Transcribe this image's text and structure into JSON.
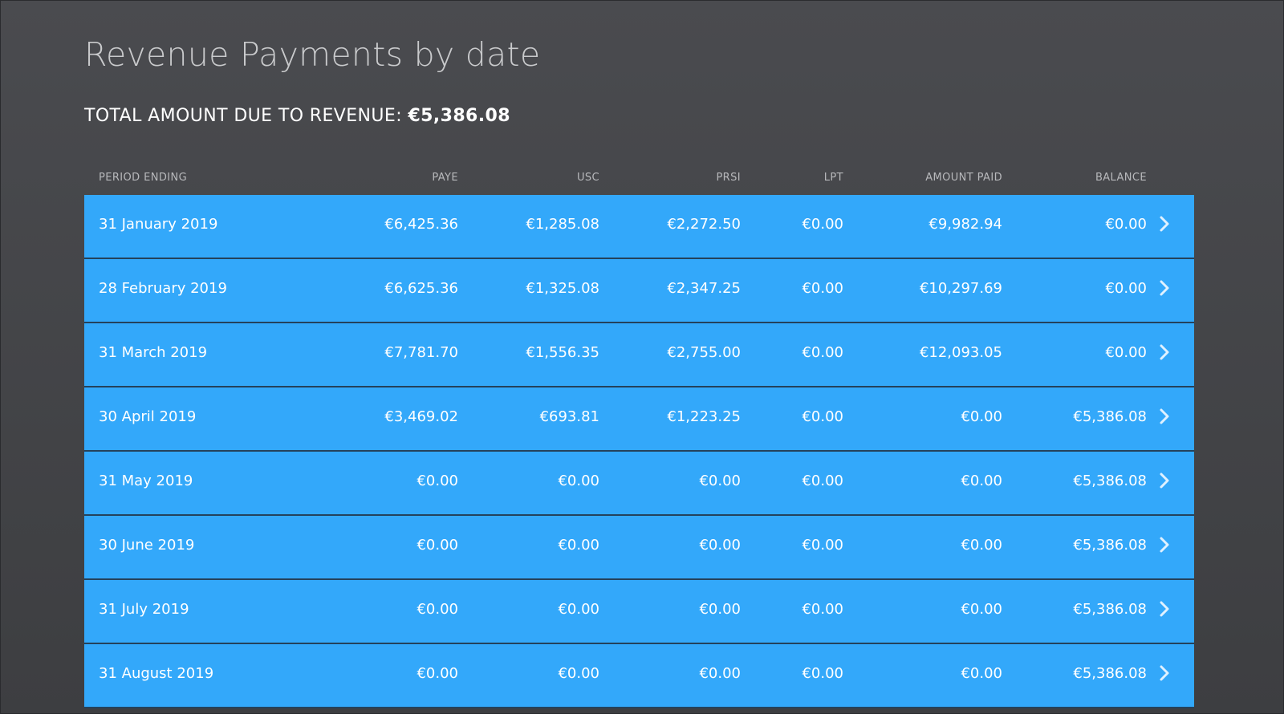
{
  "page": {
    "title": "Revenue Payments by date",
    "total_label": "TOTAL AMOUNT DUE TO REVENUE:",
    "total_amount": "€5,386.08"
  },
  "table": {
    "columns": {
      "period": "PERIOD ENDING",
      "paye": "PAYE",
      "usc": "USC",
      "prsi": "PRSI",
      "lpt": "LPT",
      "amount_paid": "AMOUNT PAID",
      "balance": "BALANCE"
    },
    "rows": [
      {
        "period": "31 January 2019",
        "paye": "€6,425.36",
        "usc": "€1,285.08",
        "prsi": "€2,272.50",
        "lpt": "€0.00",
        "amount_paid": "€9,982.94",
        "balance": "€0.00"
      },
      {
        "period": "28 February 2019",
        "paye": "€6,625.36",
        "usc": "€1,325.08",
        "prsi": "€2,347.25",
        "lpt": "€0.00",
        "amount_paid": "€10,297.69",
        "balance": "€0.00"
      },
      {
        "period": "31 March 2019",
        "paye": "€7,781.70",
        "usc": "€1,556.35",
        "prsi": "€2,755.00",
        "lpt": "€0.00",
        "amount_paid": "€12,093.05",
        "balance": "€0.00"
      },
      {
        "period": "30 April 2019",
        "paye": "€3,469.02",
        "usc": "€693.81",
        "prsi": "€1,223.25",
        "lpt": "€0.00",
        "amount_paid": "€0.00",
        "balance": "€5,386.08"
      },
      {
        "period": "31 May 2019",
        "paye": "€0.00",
        "usc": "€0.00",
        "prsi": "€0.00",
        "lpt": "€0.00",
        "amount_paid": "€0.00",
        "balance": "€5,386.08"
      },
      {
        "period": "30 June 2019",
        "paye": "€0.00",
        "usc": "€0.00",
        "prsi": "€0.00",
        "lpt": "€0.00",
        "amount_paid": "€0.00",
        "balance": "€5,386.08"
      },
      {
        "period": "31 July 2019",
        "paye": "€0.00",
        "usc": "€0.00",
        "prsi": "€0.00",
        "lpt": "€0.00",
        "amount_paid": "€0.00",
        "balance": "€5,386.08"
      },
      {
        "period": "31 August 2019",
        "paye": "€0.00",
        "usc": "€0.00",
        "prsi": "€0.00",
        "lpt": "€0.00",
        "amount_paid": "€0.00",
        "balance": "€5,386.08"
      }
    ],
    "row_icon": "chevron-right-icon"
  },
  "colors": {
    "background": "#45464a",
    "row": "#33a8fa",
    "row_separator": "#24425c",
    "title": "#c9cacc",
    "header_text": "#b8b9bc"
  }
}
